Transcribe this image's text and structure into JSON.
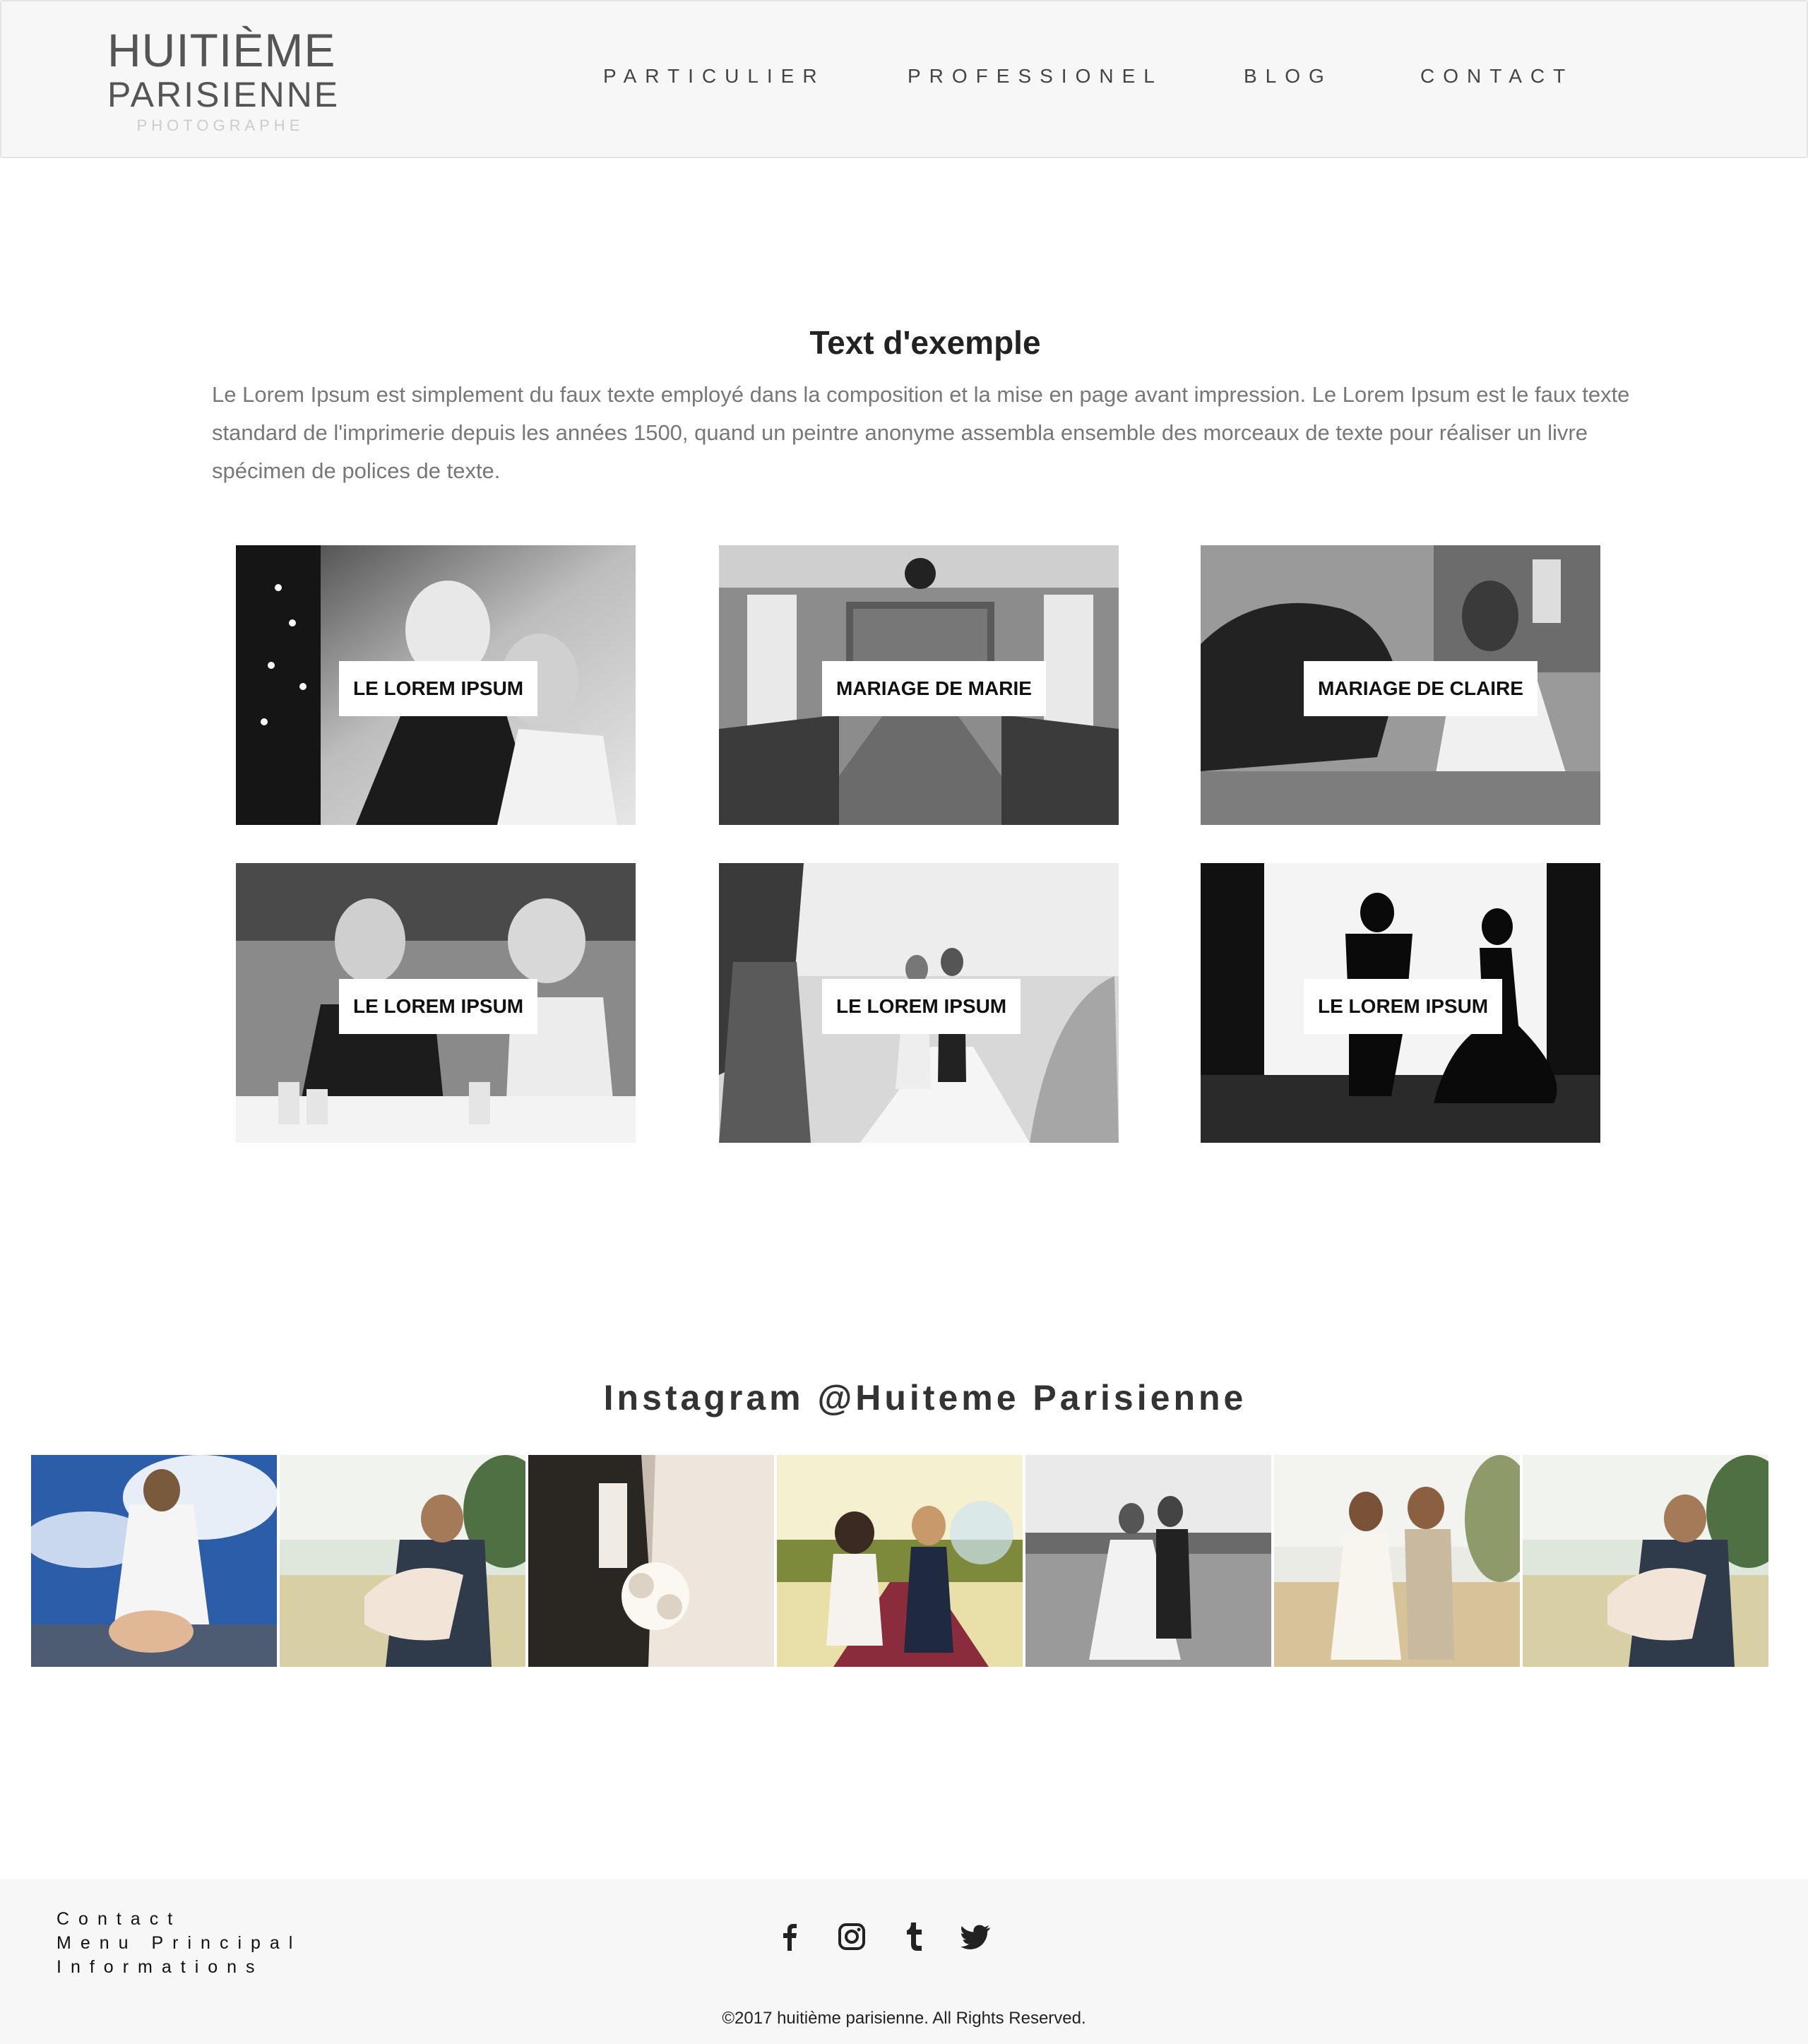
{
  "brand": {
    "line1": "HUITIÈME",
    "line2": "PARISIENNE",
    "line3": "PHOTOGRAPHE"
  },
  "nav": {
    "items": [
      {
        "label": "PARTICULIER"
      },
      {
        "label": "PROFESSIONEL"
      },
      {
        "label": "BLOG"
      },
      {
        "label": "CONTACT"
      }
    ]
  },
  "intro": {
    "title": "Text d'exemple",
    "text": "Le Lorem Ipsum est simplement du faux texte employé dans la composition et la mise en page avant impression. Le Lorem Ipsum est le faux texte standard de l'imprimerie depuis les années 1500, quand un peintre anonyme assembla ensemble des morceaux de texte pour réaliser un livre spécimen de polices de texte."
  },
  "gallery": {
    "cards": [
      {
        "label": "LE LOREM IPSUM"
      },
      {
        "label": "MARIAGE DE MARIE"
      },
      {
        "label": "MARIAGE DE CLAIRE"
      },
      {
        "label": "LE LOREM IPSUM"
      },
      {
        "label": "LE LOREM IPSUM"
      },
      {
        "label": "LE LOREM IPSUM"
      }
    ]
  },
  "instagram": {
    "title": "Instagram @Huiteme Parisienne"
  },
  "footer": {
    "links": [
      {
        "label": "Contact"
      },
      {
        "label": "Menu Principal"
      },
      {
        "label": "Informations"
      }
    ],
    "social": [
      {
        "icon": "facebook-icon"
      },
      {
        "icon": "instagram-icon"
      },
      {
        "icon": "tumblr-icon"
      },
      {
        "icon": "twitter-icon"
      }
    ],
    "copyright": "©2017 huitième parisienne. All Rights Reserved."
  }
}
